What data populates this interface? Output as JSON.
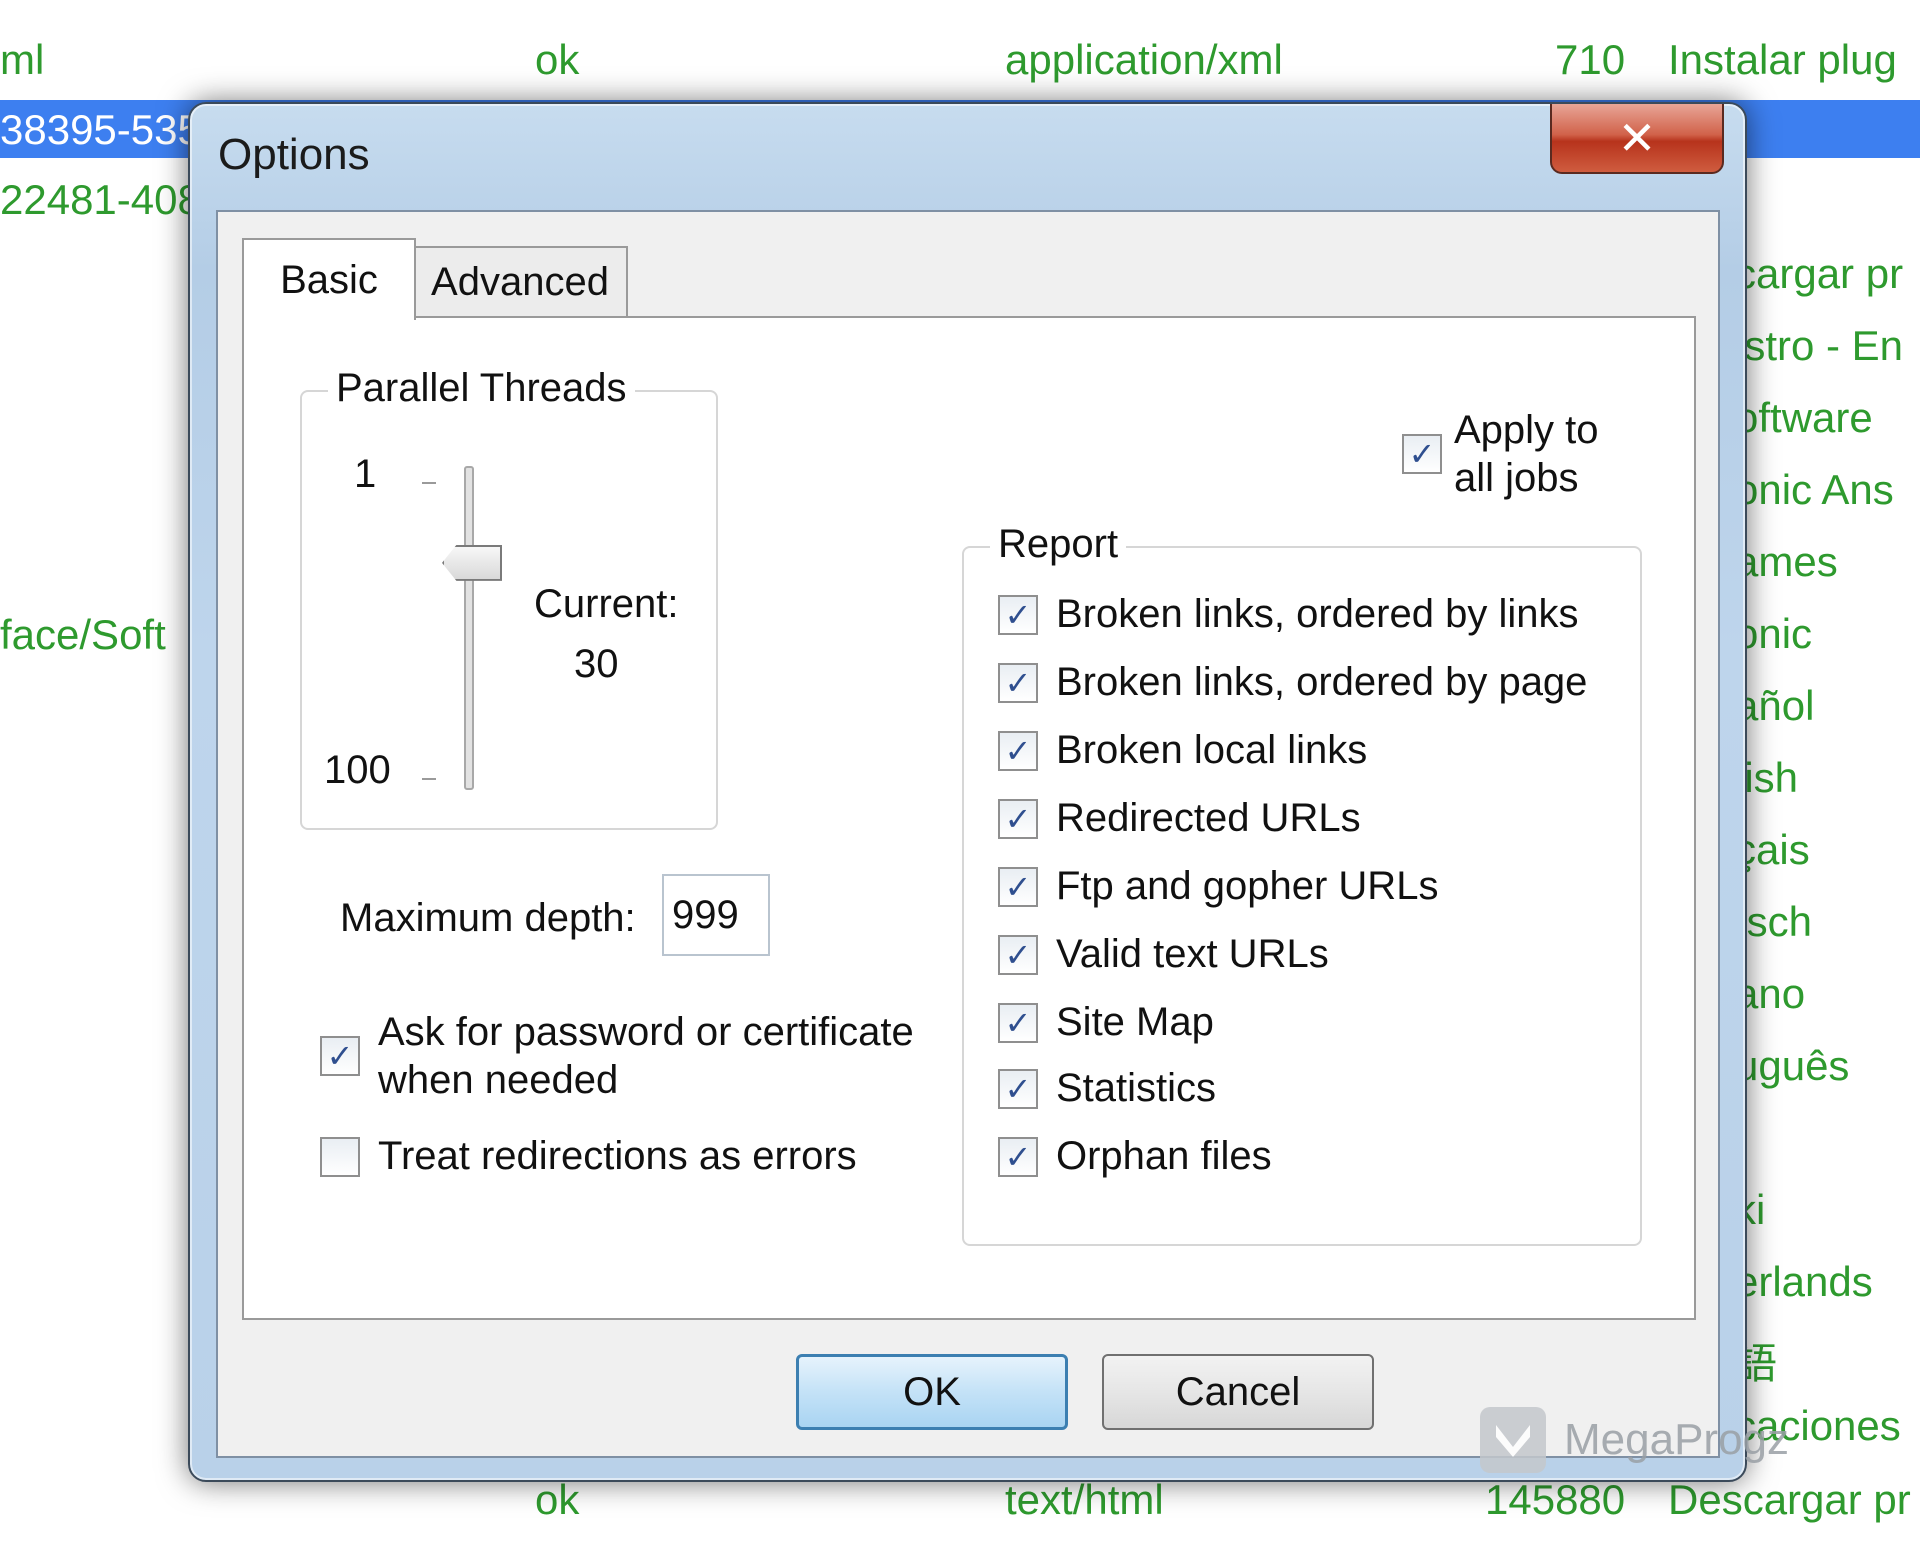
{
  "background": {
    "rows": [
      {
        "c1": "ml",
        "c2": "ok",
        "c3": "application/xml",
        "c4": "710",
        "c5": "Instalar plug"
      },
      {
        "c1": "38395-535",
        "c2": "",
        "c3": "",
        "c4": "",
        "c5": ""
      },
      {
        "c1": "22481-408",
        "c2": "",
        "c3": "",
        "c4": "",
        "c5": ""
      },
      {
        "c1": "face/Soft",
        "c2": "",
        "c3": "",
        "c4": "",
        "c5": ""
      },
      {
        "c1": "",
        "c2": "ok",
        "c3": "text/html",
        "c4": "145880",
        "c5": "Descargar pr"
      }
    ],
    "right_items": [
      "cargar pr",
      "istro - En",
      "oftware",
      "onic Ans",
      "ames",
      "onic",
      "añol",
      "lish",
      "çais",
      "tsch",
      "ano",
      "uguês",
      "ki",
      "erlands",
      "語",
      "caciones"
    ]
  },
  "dialog": {
    "title": "Options",
    "close_glyph": "✕",
    "tabs": {
      "basic": "Basic",
      "advanced": "Advanced"
    },
    "parallel_threads": {
      "legend": "Parallel Threads",
      "min_label": "1",
      "max_label": "100",
      "current_label": "Current:",
      "current_value": "30",
      "slider_value": 30
    },
    "apply_all": {
      "label_line1": "Apply to",
      "label_line2": "all jobs",
      "checked": true
    },
    "report": {
      "legend": "Report",
      "items": [
        {
          "label": "Broken links, ordered by links",
          "checked": true
        },
        {
          "label": "Broken links, ordered by page",
          "checked": true
        },
        {
          "label": "Broken local links",
          "checked": true
        },
        {
          "label": "Redirected URLs",
          "checked": true
        },
        {
          "label": "Ftp and gopher URLs",
          "checked": true
        },
        {
          "label": "Valid text URLs",
          "checked": true
        },
        {
          "label": "Site Map",
          "checked": true
        },
        {
          "label": "Statistics",
          "checked": true
        },
        {
          "label": "Orphan files",
          "checked": true
        }
      ]
    },
    "max_depth": {
      "label": "Maximum depth:",
      "value": "999"
    },
    "ask_password": {
      "label_line1": "Ask for password or certificate",
      "label_line2": "when needed",
      "checked": true
    },
    "treat_redirections": {
      "label": "Treat redirections as errors",
      "checked": false
    },
    "buttons": {
      "ok": "OK",
      "cancel": "Cancel"
    }
  },
  "watermark": {
    "text": "MegaProgz"
  },
  "check_glyph": "✓"
}
